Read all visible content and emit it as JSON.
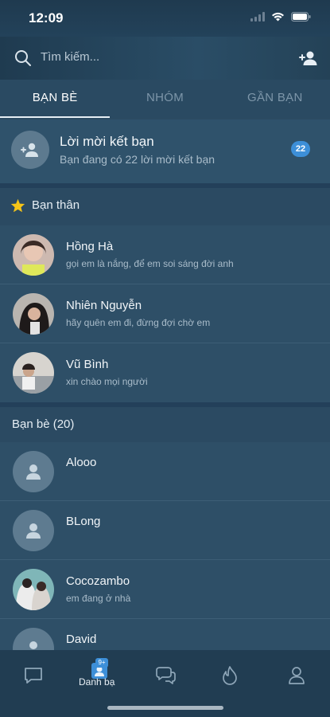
{
  "status_bar": {
    "time": "12:09"
  },
  "search": {
    "placeholder": "Tìm kiếm..."
  },
  "tabs": [
    {
      "label": "BẠN BÈ",
      "active": true
    },
    {
      "label": "NHÓM",
      "active": false
    },
    {
      "label": "GẦN BẠN",
      "active": false
    }
  ],
  "friend_request": {
    "title": "Lời mời kết bạn",
    "subtitle": "Bạn đang có 22 lời mời kết bạn",
    "badge": "22"
  },
  "close_friends": {
    "title": "Bạn thân",
    "items": [
      {
        "name": "Hồng Hà",
        "status": "gọi em là nắng, để em soi sáng đời anh"
      },
      {
        "name": "Nhiên Nguyễn",
        "status": "hãy quên em đi, đừng đợi chờ em"
      },
      {
        "name": "Vũ Bình",
        "status": "xin chào mọi người"
      }
    ]
  },
  "friends": {
    "title": "Bạn bè (20)",
    "items": [
      {
        "name": "Alooo",
        "status": ""
      },
      {
        "name": "BLong",
        "status": ""
      },
      {
        "name": "Cocozambo",
        "status": "em đang ở nhà"
      },
      {
        "name": "David",
        "status": ""
      }
    ]
  },
  "bottom_nav": {
    "contacts_label": "Danh bạ",
    "contacts_badge": "9+"
  },
  "colors": {
    "accent": "#3d8fd8",
    "background": "#2b4a62",
    "star": "#f5c518"
  }
}
